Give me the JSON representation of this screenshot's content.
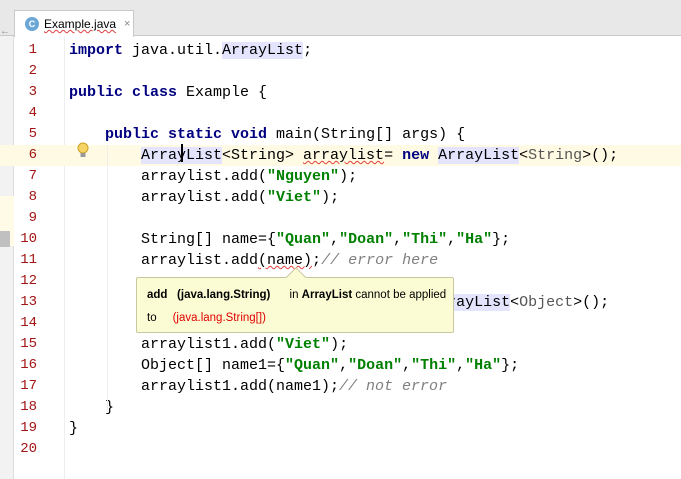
{
  "tab": {
    "title": "Example.java",
    "icon": "java-class-icon",
    "close": "×"
  },
  "lines": [
    {
      "n": "1",
      "t": [
        [
          "import",
          "kw"
        ],
        [
          " java.util.",
          ""
        ],
        [
          "ArrayList",
          "hl"
        ],
        [
          ";",
          ""
        ]
      ]
    },
    {
      "n": "2",
      "t": []
    },
    {
      "n": "3",
      "t": [
        [
          "public class",
          "kw"
        ],
        [
          " Example {",
          ""
        ]
      ]
    },
    {
      "n": "4",
      "t": []
    },
    {
      "n": "5",
      "t": [
        [
          "    ",
          ""
        ],
        [
          "public static void",
          "kw"
        ],
        [
          " main(String[] args) {",
          ""
        ]
      ]
    },
    {
      "n": "6",
      "t": [
        [
          "        ",
          ""
        ],
        [
          "ArrayList",
          "hl"
        ],
        [
          "<String> ",
          ""
        ],
        [
          "arraylist",
          "err"
        ],
        [
          "= ",
          ""
        ],
        [
          "new",
          "kw"
        ],
        [
          " ",
          ""
        ],
        [
          "ArrayList",
          "hl"
        ],
        [
          "<",
          ""
        ],
        [
          "String",
          "gen"
        ],
        [
          ">();",
          ""
        ]
      ]
    },
    {
      "n": "7",
      "t": [
        [
          "        arraylist.add(",
          ""
        ],
        [
          "\"Nguyen\"",
          "str"
        ],
        [
          ");",
          ""
        ]
      ]
    },
    {
      "n": "8",
      "t": [
        [
          "        arraylist.add(",
          ""
        ],
        [
          "\"Viet\"",
          "str"
        ],
        [
          ");",
          ""
        ]
      ]
    },
    {
      "n": "9",
      "t": []
    },
    {
      "n": "10",
      "t": [
        [
          "        String[] name={",
          ""
        ],
        [
          "\"Quan\"",
          "str"
        ],
        [
          ",",
          ""
        ],
        [
          "\"Doan\"",
          "str"
        ],
        [
          ",",
          ""
        ],
        [
          "\"Thi\"",
          "str"
        ],
        [
          ",",
          ""
        ],
        [
          "\"Ha\"",
          "str"
        ],
        [
          "};",
          ""
        ]
      ]
    },
    {
      "n": "11",
      "t": [
        [
          "        arraylist.add",
          ""
        ],
        [
          "(name)",
          "err"
        ],
        [
          ";",
          ""
        ],
        [
          "// error here",
          "cm"
        ]
      ]
    },
    {
      "n": "12",
      "t": []
    },
    {
      "n": "13",
      "t": [
        [
          "                                         ",
          ""
        ],
        [
          "rrayList",
          "hl"
        ],
        [
          "<",
          ""
        ],
        [
          "Object",
          "gen"
        ],
        [
          ">();",
          ""
        ]
      ]
    },
    {
      "n": "14",
      "t": []
    },
    {
      "n": "15",
      "t": [
        [
          "        arraylist1.add(",
          ""
        ],
        [
          "\"Viet\"",
          "str"
        ],
        [
          ");",
          ""
        ]
      ]
    },
    {
      "n": "16",
      "t": [
        [
          "        Object[] name1={",
          ""
        ],
        [
          "\"Quan\"",
          "str"
        ],
        [
          ",",
          ""
        ],
        [
          "\"Doan\"",
          "str"
        ],
        [
          ",",
          ""
        ],
        [
          "\"Thi\"",
          "str"
        ],
        [
          ",",
          ""
        ],
        [
          "\"Ha\"",
          "str"
        ],
        [
          "};",
          ""
        ]
      ]
    },
    {
      "n": "17",
      "t": [
        [
          "        arraylist1.add(name1);",
          ""
        ],
        [
          "// not error",
          "cm"
        ]
      ]
    },
    {
      "n": "18",
      "t": [
        [
          "    }",
          ""
        ]
      ]
    },
    {
      "n": "19",
      "t": [
        [
          "}",
          ""
        ]
      ]
    },
    {
      "n": "20",
      "t": []
    }
  ],
  "tooltip": {
    "method": "add",
    "param": "(java.lang.String)",
    "in": "in",
    "cls": "ArrayList",
    "msg": "cannot be applied",
    "to": "to",
    "arg": "(java.lang.String[])"
  },
  "colors": {
    "keyword": "#000080",
    "string": "#008000",
    "comment": "#808080",
    "line_number": "#a31515",
    "current_line": "#fffae3"
  }
}
